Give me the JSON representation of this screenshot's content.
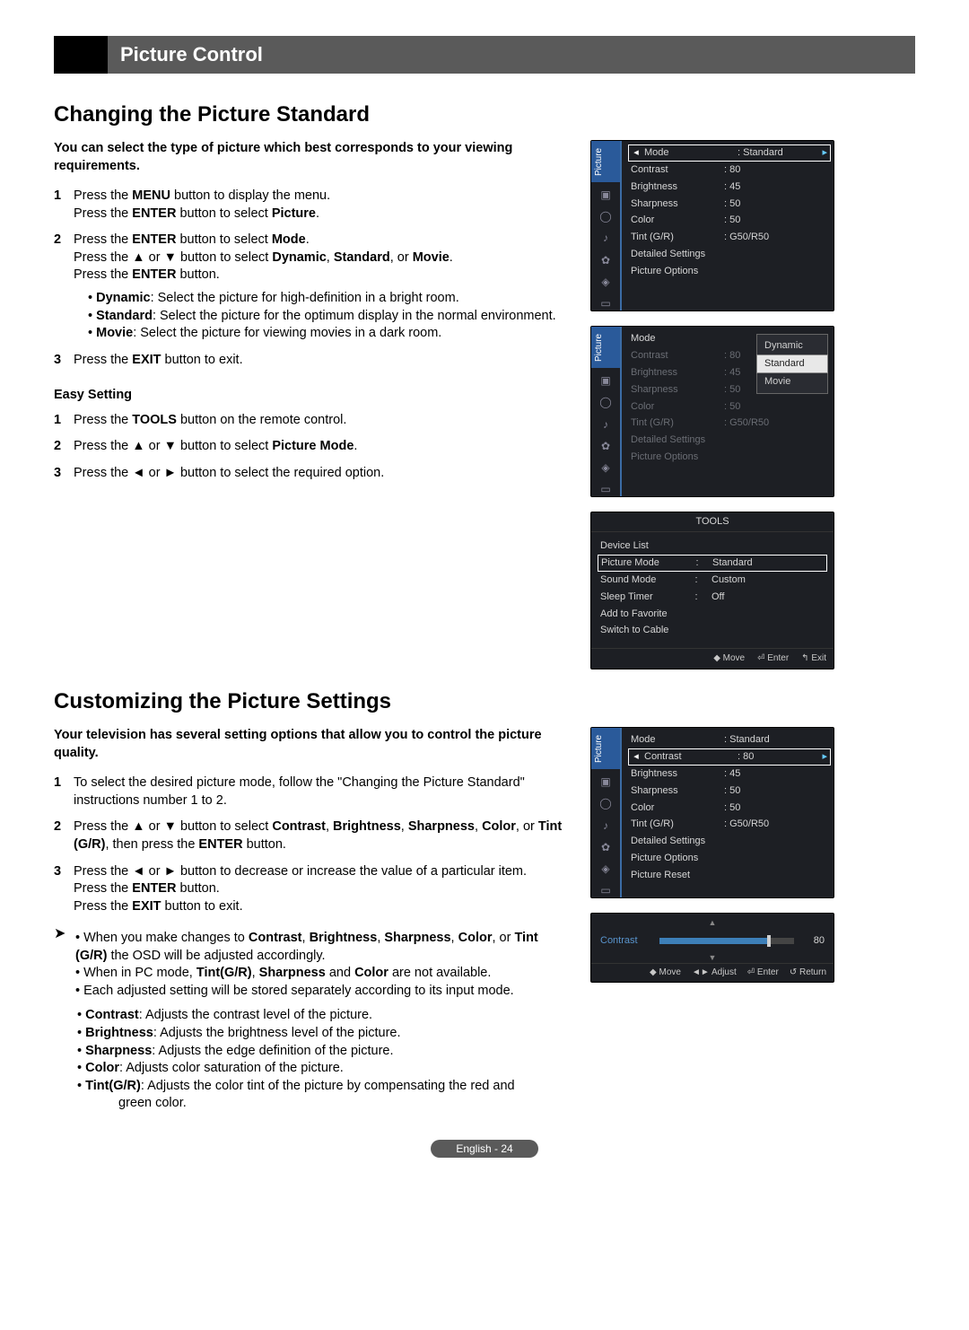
{
  "title_bar": "Picture Control",
  "section1": {
    "heading": "Changing the Picture Standard",
    "intro": "You can select the type of picture which best corresponds to your viewing requirements.",
    "steps": [
      {
        "n": "1",
        "body": "Press the <b>MENU</b> button to display the menu.<br>Press the <b>ENTER</b> button to select <b>Picture</b>."
      },
      {
        "n": "2",
        "body": "Press the <b>ENTER</b> button to select <b>Mode</b>.<br>Press the ▲ or ▼ button to select <b>Dynamic</b>, <b>Standard</b>, or <b>Movie</b>.<br>Press the <b>ENTER</b> button.",
        "bullets": [
          "<b>Dynamic</b>: Select the picture for high-definition in a bright room.",
          "<b>Standard</b>: Select the picture for the optimum display in the normal environment.",
          "<b>Movie</b>: Select the picture for viewing movies in a dark room."
        ]
      },
      {
        "n": "3",
        "body": "Press the <b>EXIT</b> button to exit."
      }
    ],
    "easy_heading": "Easy Setting",
    "easy_steps": [
      {
        "n": "1",
        "body": "Press the <b>TOOLS</b> button on the remote control."
      },
      {
        "n": "2",
        "body": "Press the ▲ or ▼ button to select <b>Picture Mode</b>."
      },
      {
        "n": "3",
        "body": "Press the ◄ or ► button to select the required option."
      }
    ]
  },
  "section2": {
    "heading": "Customizing the Picture Settings",
    "intro": "Your television has several setting options that allow you to control the picture quality.",
    "steps": [
      {
        "n": "1",
        "body": "To select the desired picture mode, follow the \"Changing the Picture Standard\" instructions number 1 to 2."
      },
      {
        "n": "2",
        "body": "Press the ▲ or ▼ button to select <b>Contrast</b>, <b>Brightness</b>, <b>Sharpness</b>, <b>Color</b>, or <b>Tint (G/R)</b>, then press the <b>ENTER</b> button."
      },
      {
        "n": "3",
        "body": "Press the ◄ or ► button to decrease or increase the value of a particular item.<br>Press the <b>ENTER</b> button.<br>Press the <b>EXIT</b> button to exit."
      }
    ],
    "arrow_notes": [
      "When you make changes to <b>Contrast</b>, <b>Brightness</b>, <b>Sharpness</b>, <b>Color</b>, or <b>Tint (G/R)</b> the OSD will be adjusted accordingly.",
      "When in PC mode, <b>Tint(G/R)</b>, <b>Sharpness</b> and <b>Color</b> are not available.",
      "Each adjusted setting will be stored separately according to its input mode."
    ],
    "definitions": [
      "<b>Contrast</b>: Adjusts the contrast level of the picture.",
      "<b>Brightness</b>: Adjusts the brightness level of the picture.",
      "<b>Sharpness</b>: Adjusts the edge definition of the picture.",
      "<b>Color</b>: Adjusts color saturation of the picture.",
      "<b>Tint(G/R)</b>: Adjusts the color tint of the picture by compensating the red and"
    ],
    "def_tail": "green color."
  },
  "osd1": {
    "tab": "Picture",
    "rows": [
      {
        "k": "Mode",
        "v": ": Standard",
        "sel": true
      },
      {
        "k": "Contrast",
        "v": ": 80"
      },
      {
        "k": "Brightness",
        "v": ": 45"
      },
      {
        "k": "Sharpness",
        "v": ": 50"
      },
      {
        "k": "Color",
        "v": ": 50"
      },
      {
        "k": "Tint (G/R)",
        "v": ": G50/R50"
      },
      {
        "k": "Detailed Settings",
        "v": ""
      },
      {
        "k": "Picture Options",
        "v": ""
      }
    ]
  },
  "osd2": {
    "tab": "Picture",
    "rows": [
      {
        "k": "Mode",
        "v": ""
      },
      {
        "k": "Contrast",
        "v": ": 80",
        "dim": true
      },
      {
        "k": "Brightness",
        "v": ": 45",
        "dim": true
      },
      {
        "k": "Sharpness",
        "v": ": 50",
        "dim": true
      },
      {
        "k": "Color",
        "v": ": 50",
        "dim": true
      },
      {
        "k": "Tint (G/R)",
        "v": ": G50/R50",
        "dim": true
      },
      {
        "k": "Detailed Settings",
        "v": "",
        "dim": true
      },
      {
        "k": "Picture Options",
        "v": "",
        "dim": true
      }
    ],
    "dropdown": [
      "Dynamic",
      "Standard",
      "Movie"
    ],
    "dropdown_selected": "Standard"
  },
  "tools": {
    "title": "TOOLS",
    "rows": [
      {
        "k": "Device List",
        "v": ""
      },
      {
        "k": "Picture Mode",
        "c": ":",
        "v": "Standard",
        "sel": true
      },
      {
        "k": "Sound Mode",
        "c": ":",
        "v": "Custom"
      },
      {
        "k": "Sleep Timer",
        "c": ":",
        "v": "Off"
      },
      {
        "k": "Add to Favorite",
        "v": ""
      },
      {
        "k": "Switch to Cable",
        "v": ""
      }
    ],
    "hints": [
      "◆ Move",
      "⏎ Enter",
      "↰ Exit"
    ]
  },
  "osd3": {
    "tab": "Picture",
    "rows": [
      {
        "k": "Mode",
        "v": ": Standard"
      },
      {
        "k": "Contrast",
        "v": ": 80",
        "sel": true
      },
      {
        "k": "Brightness",
        "v": ": 45"
      },
      {
        "k": "Sharpness",
        "v": ": 50"
      },
      {
        "k": "Color",
        "v": ": 50"
      },
      {
        "k": "Tint (G/R)",
        "v": ": G50/R50"
      },
      {
        "k": "Detailed Settings",
        "v": ""
      },
      {
        "k": "Picture Options",
        "v": ""
      },
      {
        "k": "Picture Reset",
        "v": ""
      }
    ]
  },
  "slider": {
    "label": "Contrast",
    "value": "80",
    "hints": [
      "◆ Move",
      "◄► Adjust",
      "⏎ Enter",
      "↺ Return"
    ]
  },
  "footer": "English - 24"
}
